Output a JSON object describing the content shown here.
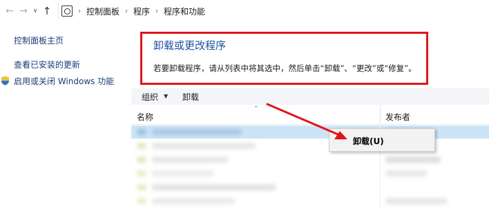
{
  "address_bar": {
    "crumbs": [
      "控制面板",
      "程序",
      "程序和功能"
    ]
  },
  "sidebar": {
    "items": [
      {
        "label": "控制面板主页"
      },
      {
        "label": "查看已安装的更新"
      },
      {
        "label": "启用或关闭 Windows 功能"
      }
    ]
  },
  "header": {
    "title": "卸载或更改程序",
    "description": "若要卸载程序，请从列表中将其选中，然后单击“卸载”、“更改”或“修复”。"
  },
  "toolbar": {
    "organize_label": "组织",
    "uninstall_label": "卸载"
  },
  "columns": {
    "name": "名称",
    "publisher": "发布者"
  },
  "context_menu": {
    "uninstall_label": "卸载(U)"
  },
  "colors": {
    "highlight_red": "#e0151b",
    "title_blue": "#1e4fa3",
    "link_blue": "#1a3c7a",
    "selection": "#cce4f7"
  }
}
